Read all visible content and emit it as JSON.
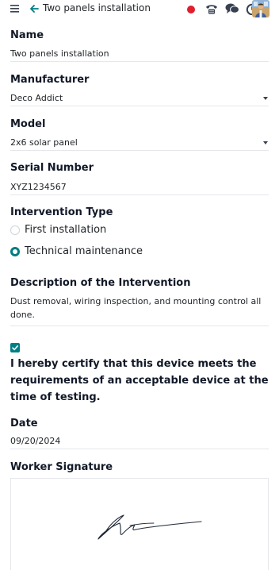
{
  "header": {
    "breadcrumb": "Two panels installation",
    "notification_count": "2",
    "icons": [
      "menu-icon",
      "back-arrow-icon",
      "recording-dot-icon",
      "phone-icon",
      "chat-icon",
      "clock-icon",
      "avatar"
    ]
  },
  "form": {
    "name": {
      "label": "Name",
      "value": "Two panels installation"
    },
    "manufacturer": {
      "label": "Manufacturer",
      "value": "Deco Addict"
    },
    "model": {
      "label": "Model",
      "value": "2x6 solar panel"
    },
    "serial": {
      "label": "Serial Number",
      "value": "XYZ1234567"
    },
    "intervention": {
      "label": "Intervention Type",
      "options": [
        {
          "label": "First installation",
          "selected": false
        },
        {
          "label": "Technical maintenance",
          "selected": true
        }
      ]
    },
    "description": {
      "label": "Description of the Intervention",
      "value": "Dust removal, wiring inspection, and mounting control all done."
    },
    "certify": {
      "checked": true,
      "text": "I hereby certify that this device meets the requirements of an acceptable device at the time of testing."
    },
    "date": {
      "label": "Date",
      "value": "09/20/2024"
    },
    "signature": {
      "label": "Worker Signature"
    }
  },
  "colors": {
    "accent": "#017e84",
    "record": "#e11d2e",
    "badge": "#e11d48",
    "text": "#212529",
    "rule": "#e5e7eb"
  }
}
